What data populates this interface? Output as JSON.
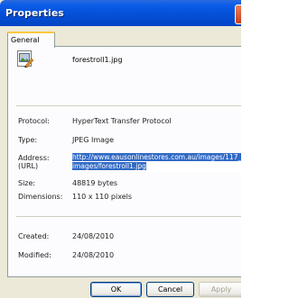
{
  "window": {
    "title": "Properties"
  },
  "tabs": [
    {
      "label": "General"
    }
  ],
  "file": {
    "name": "forestroll1.jpg",
    "icon": "image-file-icon"
  },
  "properties": {
    "protocol_label": "Protocol:",
    "protocol_value": "HyperText Transfer Protocol",
    "type_label": "Type:",
    "type_value": "JPEG Image",
    "address_label": "Address:",
    "address_label2": "(URL)",
    "address_value": "http://www.eausonlinestores.com.au/images/117_images/forestroll1.jpg",
    "size_label": "Size:",
    "size_value": "48819 bytes",
    "dimensions_label": "Dimensions:",
    "dimensions_value": "110 x 110 pixels",
    "created_label": "Created:",
    "created_value": "24/08/2010",
    "modified_label": "Modified:",
    "modified_value": "24/08/2010"
  },
  "buttons": {
    "ok": "OK",
    "cancel": "Cancel",
    "apply": "Apply"
  },
  "colors": {
    "titlebar": "#0550d8",
    "selection": "#316ac5",
    "tab_accent": "#ffc83c"
  }
}
